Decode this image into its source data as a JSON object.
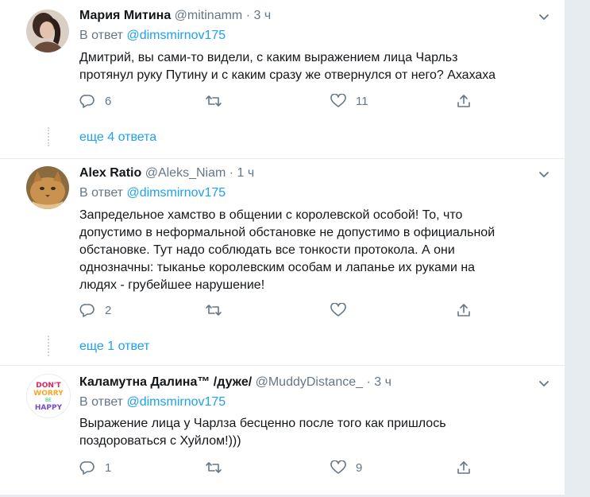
{
  "tweets": [
    {
      "name": "Мария Митина",
      "handle": "@mitinamm",
      "dot": "·",
      "time": "3 ч",
      "reply_prefix": "В ответ",
      "reply_handle": "@dimsmirnov175",
      "text_lines": [
        "Дмитрий, вы сами-то видели, с каким выражением лица Чарльз",
        "протянул руку Путину и с каким сразу же отвернулся от него? Ахахаха"
      ],
      "replies": "6",
      "retweets": "",
      "likes": "11",
      "more_label": "еще 4 ответа"
    },
    {
      "name": "Alex Ratio",
      "handle": "@Aleks_Niam",
      "dot": "·",
      "time": "1 ч",
      "reply_prefix": "В ответ",
      "reply_handle": "@dimsmirnov175",
      "text_lines": [
        "Запредельное хамство в общении с королевской особой! То, что",
        "допустимо в неформальной обстановке не допустимо в официальной",
        "обстановке. Тут надо соблюдать все тонкости протокола. А они",
        "однозначны: тыканье королевским особам и лапанье их руками на",
        "людях - грубейшее нарушение!"
      ],
      "replies": "2",
      "retweets": "",
      "likes": "",
      "more_label": "еще 1 ответ"
    },
    {
      "name": "Каламутна Далина™ /дуже/",
      "handle": "@MuddyDistance_",
      "dot": "·",
      "time": "3 ч",
      "reply_prefix": "В ответ",
      "reply_handle": "@dimsmirnov175",
      "text_lines": [
        "Выражение лица у Чарлза бесценно после того как пришлось",
        "поздороваться с Хуйлом!)))"
      ],
      "replies": "1",
      "retweets": "",
      "likes": "9",
      "more_label": "",
      "avatar_text": [
        "DON'T",
        "WORRY",
        "BE",
        "HAPPY"
      ]
    }
  ],
  "colors": {
    "accent": "#1da1f2",
    "muted": "#657786",
    "text": "#14171a",
    "background": "#e6ecf0"
  },
  "icons": [
    "reply-icon",
    "retweet-icon",
    "like-icon",
    "share-icon",
    "chevron-down-icon"
  ]
}
